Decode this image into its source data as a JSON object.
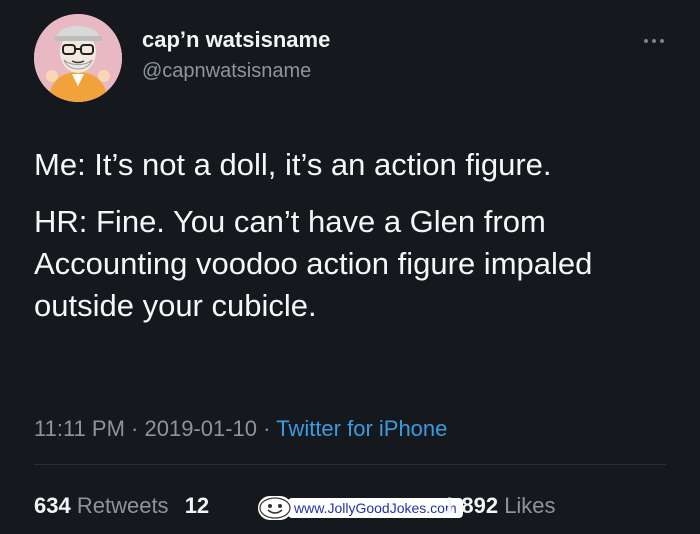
{
  "author": {
    "display_name": "cap’n watsisname",
    "handle": "@capnwatsisname",
    "avatar_icon": "cartoon-avatar-icon"
  },
  "more_icon": "more-dots-icon",
  "tweet": {
    "paragraphs": [
      "Me: It’s not a doll, it’s an action figure.",
      "HR: Fine. You can’t have a Glen from Accounting voodoo action figure impaled outside your cubicle."
    ]
  },
  "meta": {
    "time": "11:11 PM",
    "date": "2019-01-10",
    "separator": "·",
    "source": "Twitter for iPhone"
  },
  "stats": {
    "retweets_count": "634",
    "retweets_label": "Retweets",
    "quotes_count": "12",
    "likes_count": "1,892",
    "likes_label": "Likes"
  },
  "watermark": {
    "text": "www.JollyGoodJokes.com"
  },
  "colors": {
    "background": "#15181d",
    "text": "#f3f4f6",
    "muted": "#8d949b",
    "link": "#3a9be0"
  }
}
